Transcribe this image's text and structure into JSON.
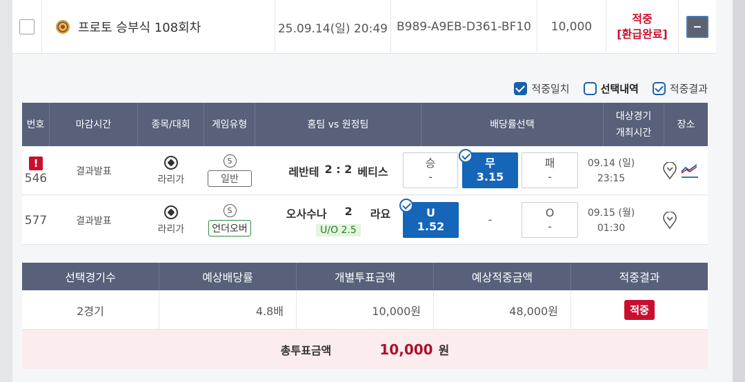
{
  "summary": {
    "game_name": "프로토 승부식 108회차",
    "datetime": "25.09.14(일) 20:49",
    "ticket_id": "B989-A9EB-D361-BF10",
    "amount": "10,000",
    "result_line1": "적중",
    "result_line2": "[환급완료]"
  },
  "filters": [
    {
      "label": "적중일치",
      "checked": true
    },
    {
      "label": "선택내역",
      "checked": false
    },
    {
      "label": "적중결과",
      "checked": true
    }
  ],
  "table_headers": {
    "num": "번호",
    "deadline": "마감시간",
    "sport": "종목/대회",
    "game_type": "게임유형",
    "teams": "홈팀 vs 원정팀",
    "odds": "배당률선택",
    "match_time_l1": "대상경기",
    "match_time_l2": "개최시간",
    "venue": "장소"
  },
  "rows": [
    {
      "num": "546",
      "alert": "!",
      "deadline": "결과발표",
      "league": "라리가",
      "type_letter": "S",
      "type": "일반",
      "home": "레반테",
      "score": "2 : 2",
      "away": "베티스",
      "odds": [
        {
          "label": "승",
          "value": "-"
        },
        {
          "label": "무",
          "value": "3.15"
        },
        {
          "label": "패",
          "value": "-"
        }
      ],
      "date": "09.14 (일)",
      "time": "23:15"
    },
    {
      "num": "577",
      "deadline": "결과발표",
      "league": "라리가",
      "type_letter": "S",
      "type": "언더오버",
      "home": "오사수나",
      "score": "2",
      "away": "라요",
      "uo": "U/O 2.5",
      "odds": [
        {
          "label": "U",
          "value": "1.52"
        },
        {
          "label": "",
          "value": "-"
        },
        {
          "label": "O",
          "value": "-"
        }
      ],
      "date": "09.15 (월)",
      "time": "01:30"
    }
  ],
  "bottom_headers": {
    "count": "선택경기수",
    "expected_odds": "예상배당률",
    "bet_amount": "개별투표금액",
    "expected_win": "예상적중금액",
    "result": "적중결과"
  },
  "bottom_values": {
    "count": "2경기",
    "expected_odds": "4.8배",
    "bet_amount": "10,000원",
    "expected_win": "48,000원",
    "result": "적중"
  },
  "total": {
    "label": "총투표금액",
    "value": "10,000",
    "unit": "원"
  },
  "colors": {
    "header_bg": "#58607a",
    "selected_blue": "#1565b8",
    "hit_red": "#c8102e"
  }
}
